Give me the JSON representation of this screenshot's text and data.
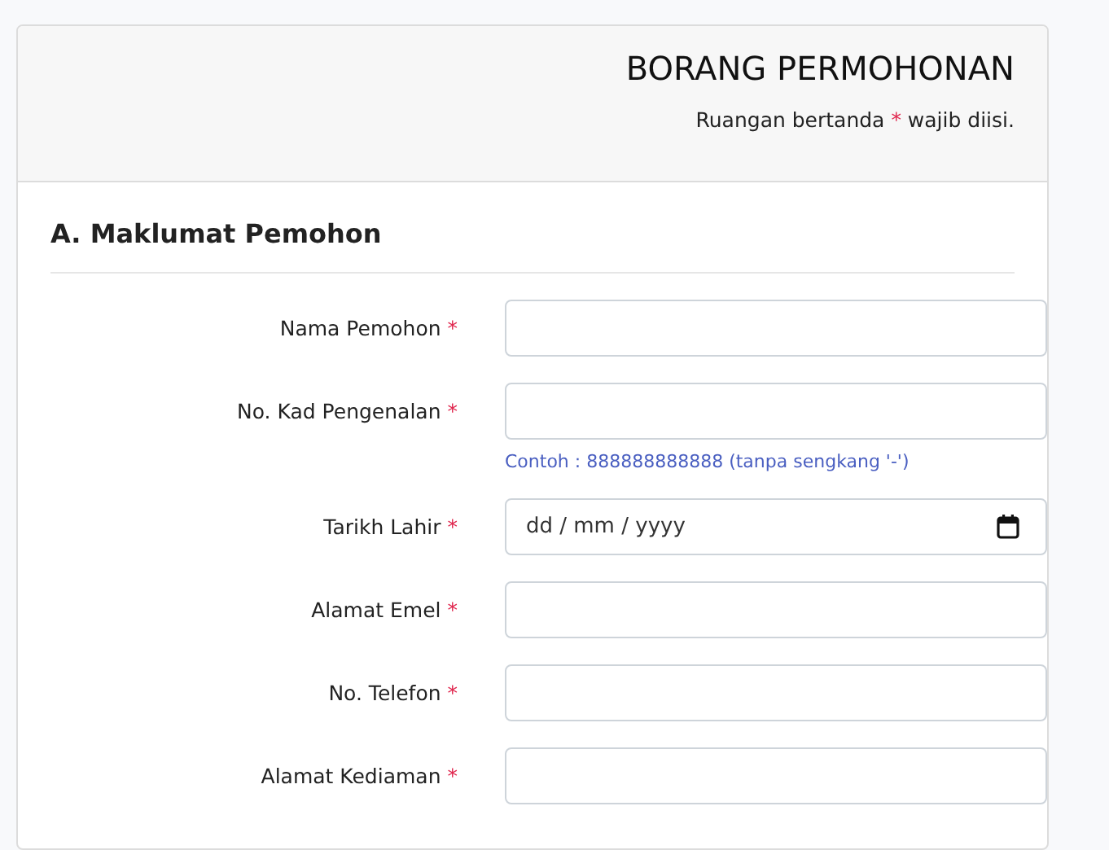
{
  "header": {
    "title": "BORANG PERMOHONAN",
    "note": {
      "before": "Ruangan bertanda",
      "mark": "*",
      "after": "wajib diisi."
    }
  },
  "section": {
    "title": "A. Maklumat Pemohon"
  },
  "fields": [
    {
      "kind": "text",
      "label": "Nama Pemohon",
      "required_mark": "*"
    },
    {
      "kind": "text",
      "label": "No. Kad Pengenalan",
      "required_mark": "*",
      "hint": "Contoh : 888888888888 (tanpa sengkang '-')"
    },
    {
      "kind": "date",
      "label": "Tarikh Lahir",
      "required_mark": "*",
      "placeholder": "dd / mm / yyyy"
    },
    {
      "kind": "text",
      "label": "Alamat Emel",
      "required_mark": "*"
    },
    {
      "kind": "text",
      "label": "No. Telefon",
      "required_mark": "*"
    },
    {
      "kind": "text",
      "label": "Alamat Kediaman",
      "required_mark": "*"
    }
  ]
}
